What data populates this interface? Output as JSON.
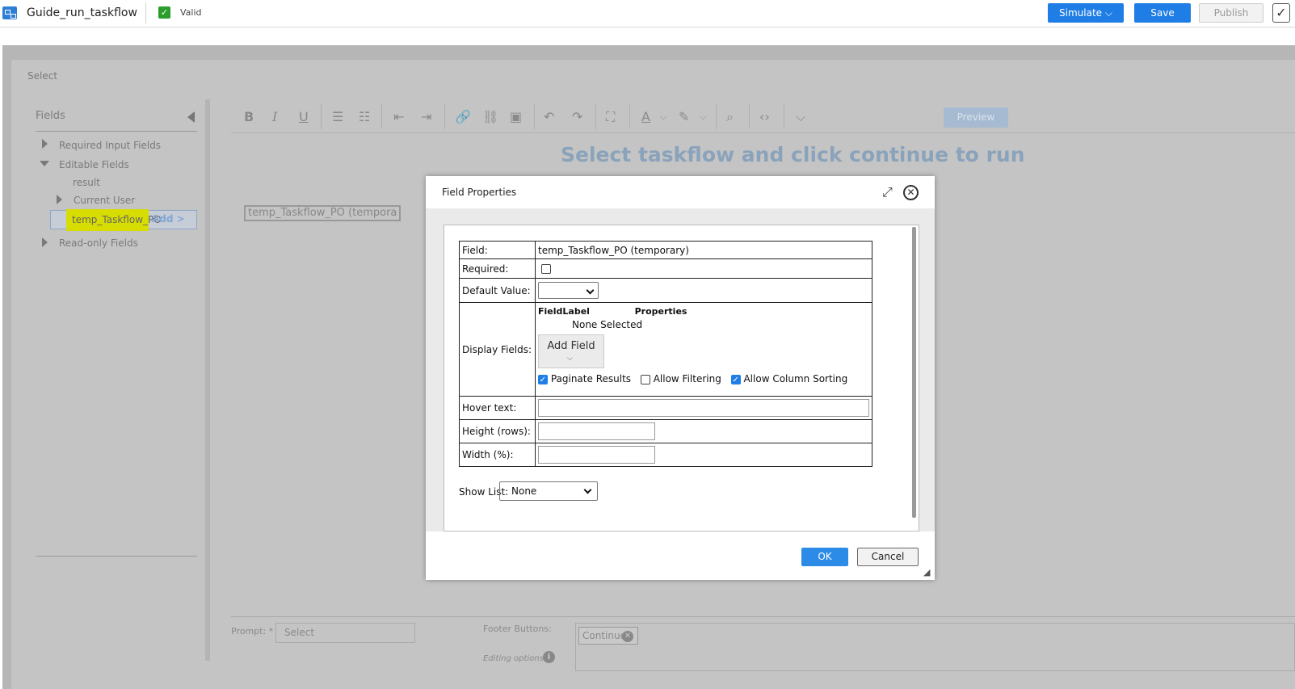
{
  "header": {
    "title": "Guide_run_taskflow",
    "valid_label": "Valid",
    "simulate_label": "Simulate ⌵",
    "save_label": "Save",
    "publish_label": "Publish"
  },
  "panel": {
    "title": "Select"
  },
  "fields": {
    "header": "Fields",
    "tree": [
      {
        "label": "Required Input Fields"
      },
      {
        "label": "Editable Fields"
      },
      {
        "label": "result"
      },
      {
        "label": "Current User"
      },
      {
        "label": "temp_Taskflow_PO"
      },
      {
        "label": "Read-only Fields"
      }
    ],
    "add_label": "Add >"
  },
  "editor": {
    "preview_label": "Preview",
    "heading": "Select taskflow and click continue to run",
    "field_chip": "temp_Taskflow_PO (tempora"
  },
  "footer": {
    "prompt_label": "Prompt: *",
    "prompt_value": "Select",
    "footer_buttons_label": "Footer Buttons:",
    "continue_chip": "Continue",
    "editing_options": "Editing options"
  },
  "dialog": {
    "title": "Field Properties",
    "rows": {
      "field_label": "Field:",
      "field_value": "temp_Taskflow_PO (temporary)",
      "required_label": "Required:",
      "default_label": "Default Value:",
      "display_label": "Display Fields:",
      "col_fieldlabel": "FieldLabel",
      "col_properties": "Properties",
      "none_selected": "None Selected",
      "add_field": "Add Field",
      "paginate": "Paginate Results",
      "filtering": "Allow Filtering",
      "sorting": "Allow Column Sorting",
      "hover_label": "Hover text:",
      "height_label": "Height (rows):",
      "width_label": "Width (%):"
    },
    "show_list_label": "Show List:",
    "show_list_value": "None",
    "ok_label": "OK",
    "cancel_label": "Cancel"
  }
}
